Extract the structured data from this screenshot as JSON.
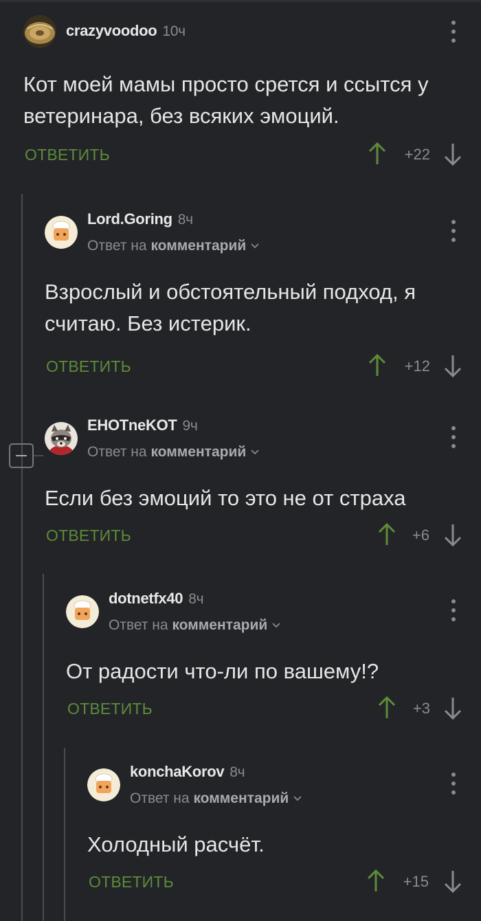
{
  "comments": [
    {
      "author": "crazyvoodoo",
      "time": "10ч",
      "reply_prefix": "",
      "reply_link": "",
      "text": "Кот моей мамы просто срется и ссытся у ветеринара, без всяких эмоций.",
      "reply_label": "ОТВЕТИТЬ",
      "score": "+22",
      "avatar": "cymbal-avatar"
    },
    {
      "author": "Lord.Goring",
      "time": "8ч",
      "reply_prefix": "Ответ на",
      "reply_link": "комментарий",
      "text": "Взрослый и обстоятельный подход, я считаю. Без истерик.",
      "reply_label": "ОТВЕТИТЬ",
      "score": "+12",
      "avatar": "chef-avatar"
    },
    {
      "author": "EHOTneKOT",
      "time": "9ч",
      "reply_prefix": "Ответ на",
      "reply_link": "комментарий",
      "text": "Если без эмоций то это не от страха",
      "reply_label": "ОТВЕТИТЬ",
      "score": "+6",
      "avatar": "raccoon-avatar"
    },
    {
      "author": "dotnetfx40",
      "time": "8ч",
      "reply_prefix": "Ответ на",
      "reply_link": "комментарий",
      "text": "От радости что-ли по вашему!?",
      "reply_label": "ОТВЕТИТЬ",
      "score": "+3",
      "avatar": "chef-avatar"
    },
    {
      "author": "konchaKorov",
      "time": "8ч",
      "reply_prefix": "Ответ на",
      "reply_link": "комментарий",
      "text": "Холодный расчёт.",
      "reply_label": "ОТВЕТИТЬ",
      "score": "+15",
      "avatar": "chef-avatar"
    }
  ],
  "colors": {
    "background": "#232427",
    "accent_green": "#5d8b3a",
    "muted": "#8a8b8f",
    "thread_line": "#4a4b4f"
  }
}
